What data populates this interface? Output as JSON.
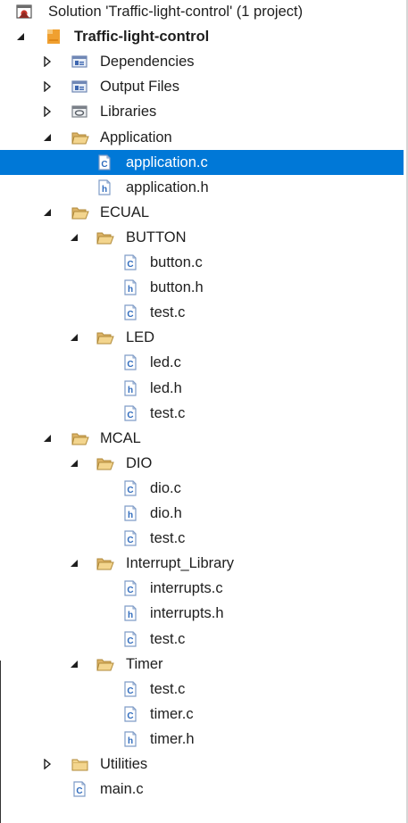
{
  "tree": [
    {
      "label": "Solution 'Traffic-light-control' (1 project)",
      "icon": "solution-icon",
      "expander": "none",
      "depth": 0
    },
    {
      "label": "Traffic-light-control",
      "icon": "project-icon",
      "expander": "expanded",
      "depth": 1,
      "bold": true
    },
    {
      "label": "Dependencies",
      "icon": "dependencies-icon",
      "expander": "collapsed",
      "depth": 2
    },
    {
      "label": "Output Files",
      "icon": "output-files-icon",
      "expander": "collapsed",
      "depth": 2
    },
    {
      "label": "Libraries",
      "icon": "libraries-icon",
      "expander": "collapsed",
      "depth": 2
    },
    {
      "label": "Application",
      "icon": "folder-open-icon",
      "expander": "expanded",
      "depth": 2
    },
    {
      "label": "application.c",
      "icon": "c-file-icon",
      "expander": "none",
      "depth": 3,
      "selected": true
    },
    {
      "label": "application.h",
      "icon": "h-file-icon",
      "expander": "none",
      "depth": 3
    },
    {
      "label": "ECUAL",
      "icon": "folder-open-icon",
      "expander": "expanded",
      "depth": 2
    },
    {
      "label": "BUTTON",
      "icon": "folder-open-icon",
      "expander": "expanded",
      "depth": 3
    },
    {
      "label": "button.c",
      "icon": "c-file-icon",
      "expander": "none",
      "depth": 4
    },
    {
      "label": "button.h",
      "icon": "h-file-icon",
      "expander": "none",
      "depth": 4
    },
    {
      "label": "test.c",
      "icon": "c-file-icon",
      "expander": "none",
      "depth": 4
    },
    {
      "label": "LED",
      "icon": "folder-open-icon",
      "expander": "expanded",
      "depth": 3
    },
    {
      "label": "led.c",
      "icon": "c-file-icon",
      "expander": "none",
      "depth": 4
    },
    {
      "label": "led.h",
      "icon": "h-file-icon",
      "expander": "none",
      "depth": 4
    },
    {
      "label": "test.c",
      "icon": "c-file-icon",
      "expander": "none",
      "depth": 4
    },
    {
      "label": "MCAL",
      "icon": "folder-open-icon",
      "expander": "expanded",
      "depth": 2
    },
    {
      "label": "DIO",
      "icon": "folder-open-icon",
      "expander": "expanded",
      "depth": 3
    },
    {
      "label": "dio.c",
      "icon": "c-file-icon",
      "expander": "none",
      "depth": 4
    },
    {
      "label": "dio.h",
      "icon": "h-file-icon",
      "expander": "none",
      "depth": 4
    },
    {
      "label": "test.c",
      "icon": "c-file-icon",
      "expander": "none",
      "depth": 4
    },
    {
      "label": "Interrupt_Library",
      "icon": "folder-open-icon",
      "expander": "expanded",
      "depth": 3
    },
    {
      "label": "interrupts.c",
      "icon": "c-file-icon",
      "expander": "none",
      "depth": 4
    },
    {
      "label": "interrupts.h",
      "icon": "h-file-icon",
      "expander": "none",
      "depth": 4
    },
    {
      "label": "test.c",
      "icon": "c-file-icon",
      "expander": "none",
      "depth": 4
    },
    {
      "label": "Timer",
      "icon": "folder-open-icon",
      "expander": "expanded",
      "depth": 3
    },
    {
      "label": "test.c",
      "icon": "c-file-icon",
      "expander": "none",
      "depth": 4
    },
    {
      "label": "timer.c",
      "icon": "c-file-icon",
      "expander": "none",
      "depth": 4
    },
    {
      "label": "timer.h",
      "icon": "h-file-icon",
      "expander": "none",
      "depth": 4
    },
    {
      "label": "Utilities",
      "icon": "folder-closed-icon",
      "expander": "collapsed",
      "depth": 2
    },
    {
      "label": "main.c",
      "icon": "c-file-icon",
      "expander": "none",
      "depth": 2
    }
  ]
}
